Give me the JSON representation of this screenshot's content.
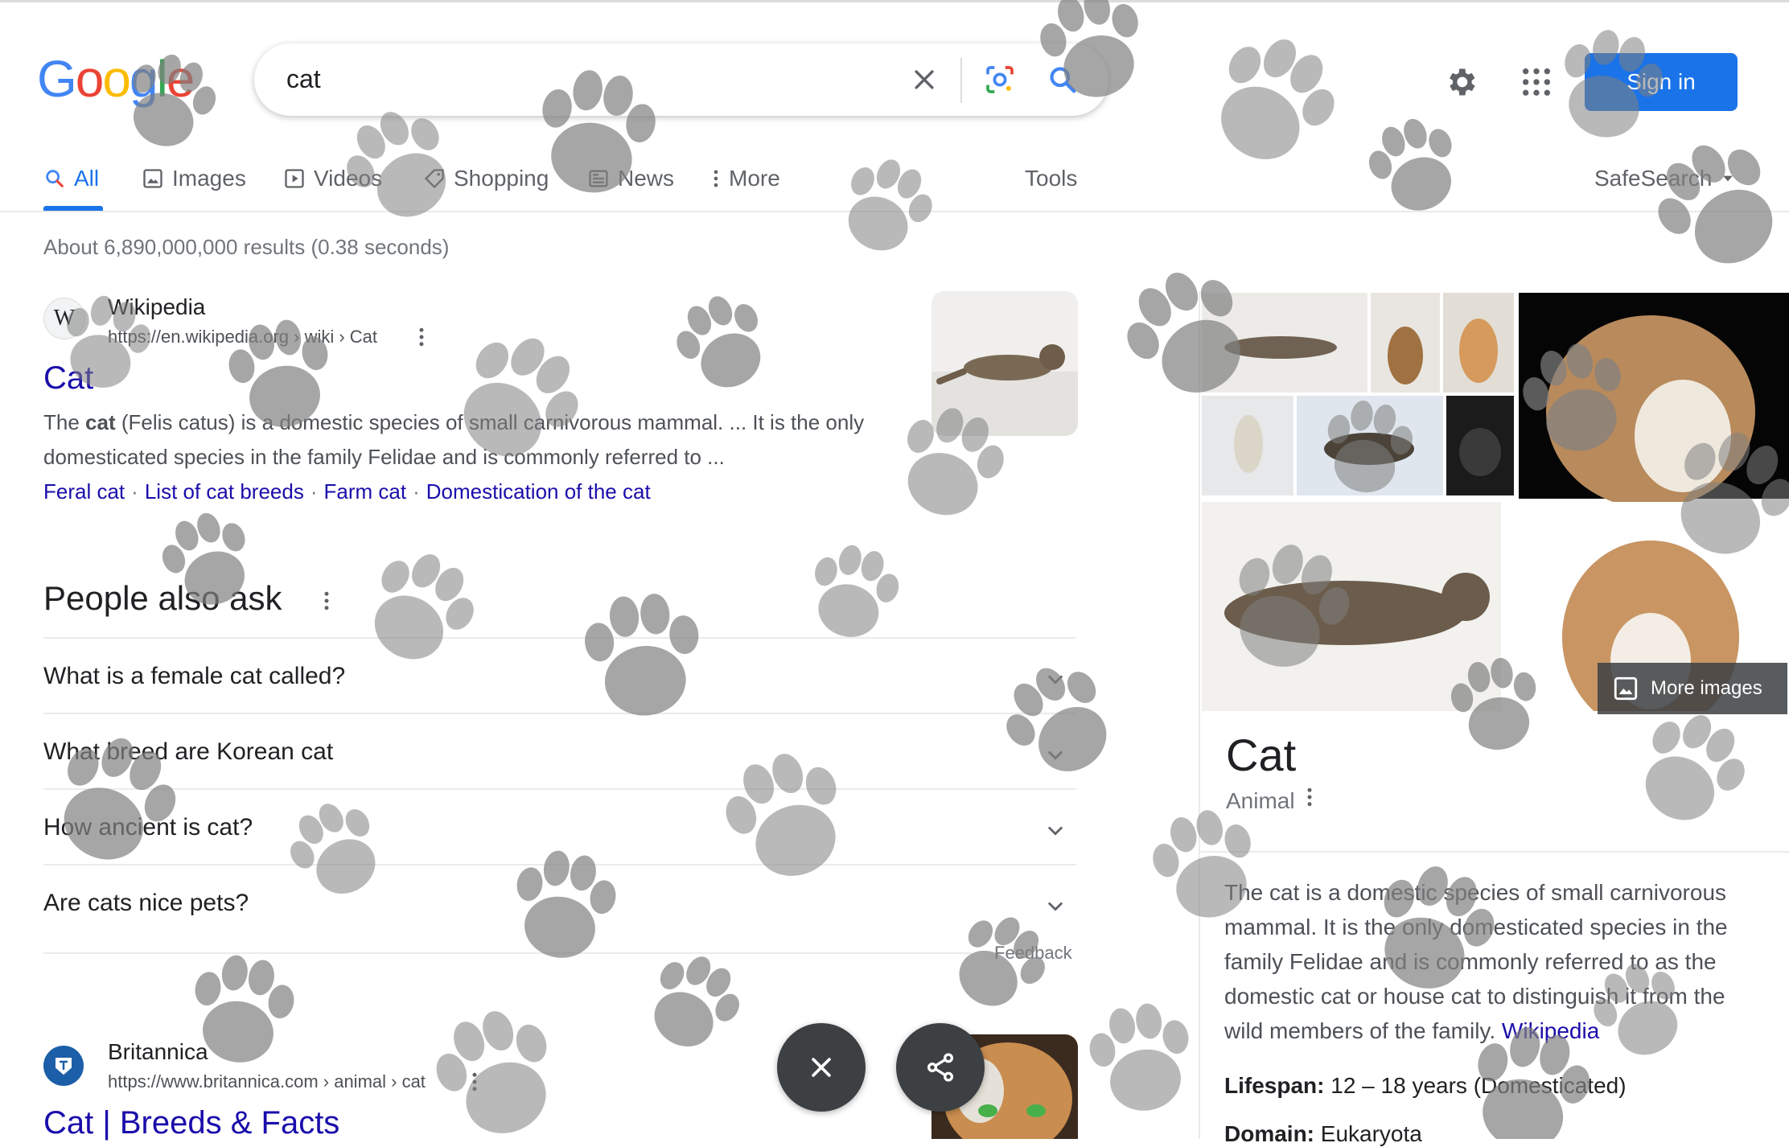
{
  "header": {
    "logo": "Google",
    "query": "cat",
    "signin_label": "Sign in"
  },
  "tabs": [
    {
      "label": "All",
      "icon": "search-icon"
    },
    {
      "label": "Images",
      "icon": "image-icon"
    },
    {
      "label": "Videos",
      "icon": "play-icon"
    },
    {
      "label": "Shopping",
      "icon": "tag-icon"
    },
    {
      "label": "News",
      "icon": "newspaper-icon"
    },
    {
      "label": "More",
      "icon": "kebab-icon"
    }
  ],
  "tools_label": "Tools",
  "safesearch_label": "SafeSearch",
  "stats": "About 6,890,000,000 results (0.38 seconds)",
  "results": [
    {
      "site": "Wikipedia",
      "url": "https://en.wikipedia.org › wiki › Cat",
      "title": "Cat",
      "snippet_pre": "The ",
      "snippet_bold": "cat",
      "snippet_post": " (Felis catus) is a domestic species of small carnivorous mammal. ... It is the only domesticated species in the family Felidae and is commonly referred to ...",
      "sitelinks": [
        "Feral cat",
        "List of cat breeds",
        "Farm cat",
        "Domestication of the cat"
      ]
    },
    {
      "site": "Britannica",
      "url": "https://www.britannica.com › animal › cat",
      "title": "Cat | Breeds & Facts"
    }
  ],
  "paa": {
    "title": "People also ask",
    "questions": [
      "What is a female cat called?",
      "What breed are Korean cat",
      "How ancient is cat?",
      "Are cats nice pets?"
    ],
    "feedback": "Feedback"
  },
  "knowledge_panel": {
    "title": "Cat",
    "subtitle": "Animal",
    "more_images": "More images",
    "description": "The cat is a domestic species of small carnivorous mammal. It is the only domesticated species in the family Felidae and is commonly referred to as the domestic cat or house cat to distinguish it from the wild members of the family.",
    "source_link": "Wikipedia",
    "facts": [
      {
        "label": "Lifespan:",
        "value": "12 – 18 years (Domesticated)"
      },
      {
        "label": "Domain:",
        "value": "Eukaryota"
      }
    ]
  },
  "colors": {
    "accent": "#1a73e8",
    "link": "#1a0dab",
    "paw": "#808080"
  }
}
